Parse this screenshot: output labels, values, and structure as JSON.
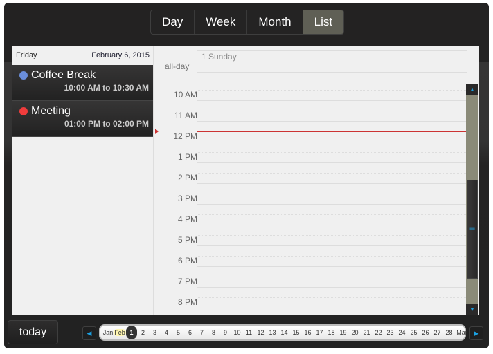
{
  "views": [
    {
      "label": "Day",
      "active": false
    },
    {
      "label": "Week",
      "active": false
    },
    {
      "label": "Month",
      "active": false
    },
    {
      "label": "List",
      "active": true
    }
  ],
  "list": {
    "day_name": "Friday",
    "date": "February 6, 2015",
    "events": [
      {
        "title": "Coffee Break",
        "time": "10:00 AM to 10:30 AM",
        "color": "#6a8edb"
      },
      {
        "title": "Meeting",
        "time": "01:00 PM to 02:00 PM",
        "color": "#f03c3c"
      }
    ]
  },
  "allday": {
    "label": "all-day",
    "column": "1 Sunday"
  },
  "hours": [
    "10 AM",
    "11 AM",
    "12 PM",
    "1 PM",
    "2 PM",
    "3 PM",
    "4 PM",
    "5 PM",
    "6 PM",
    "7 PM",
    "8 PM"
  ],
  "today_label": "today",
  "strip": {
    "prev_month": "Jan",
    "current_month": "Feb",
    "next_month": "Mar",
    "selected_day": "1",
    "days": [
      "1",
      "2",
      "3",
      "4",
      "5",
      "6",
      "7",
      "8",
      "9",
      "10",
      "11",
      "12",
      "13",
      "14",
      "15",
      "16",
      "17",
      "18",
      "19",
      "20",
      "21",
      "22",
      "23",
      "24",
      "25",
      "26",
      "27",
      "28"
    ]
  },
  "colors": {
    "accent": "#1ba1e2",
    "now_line": "#cc3333",
    "active_view": "#5f5f55"
  }
}
